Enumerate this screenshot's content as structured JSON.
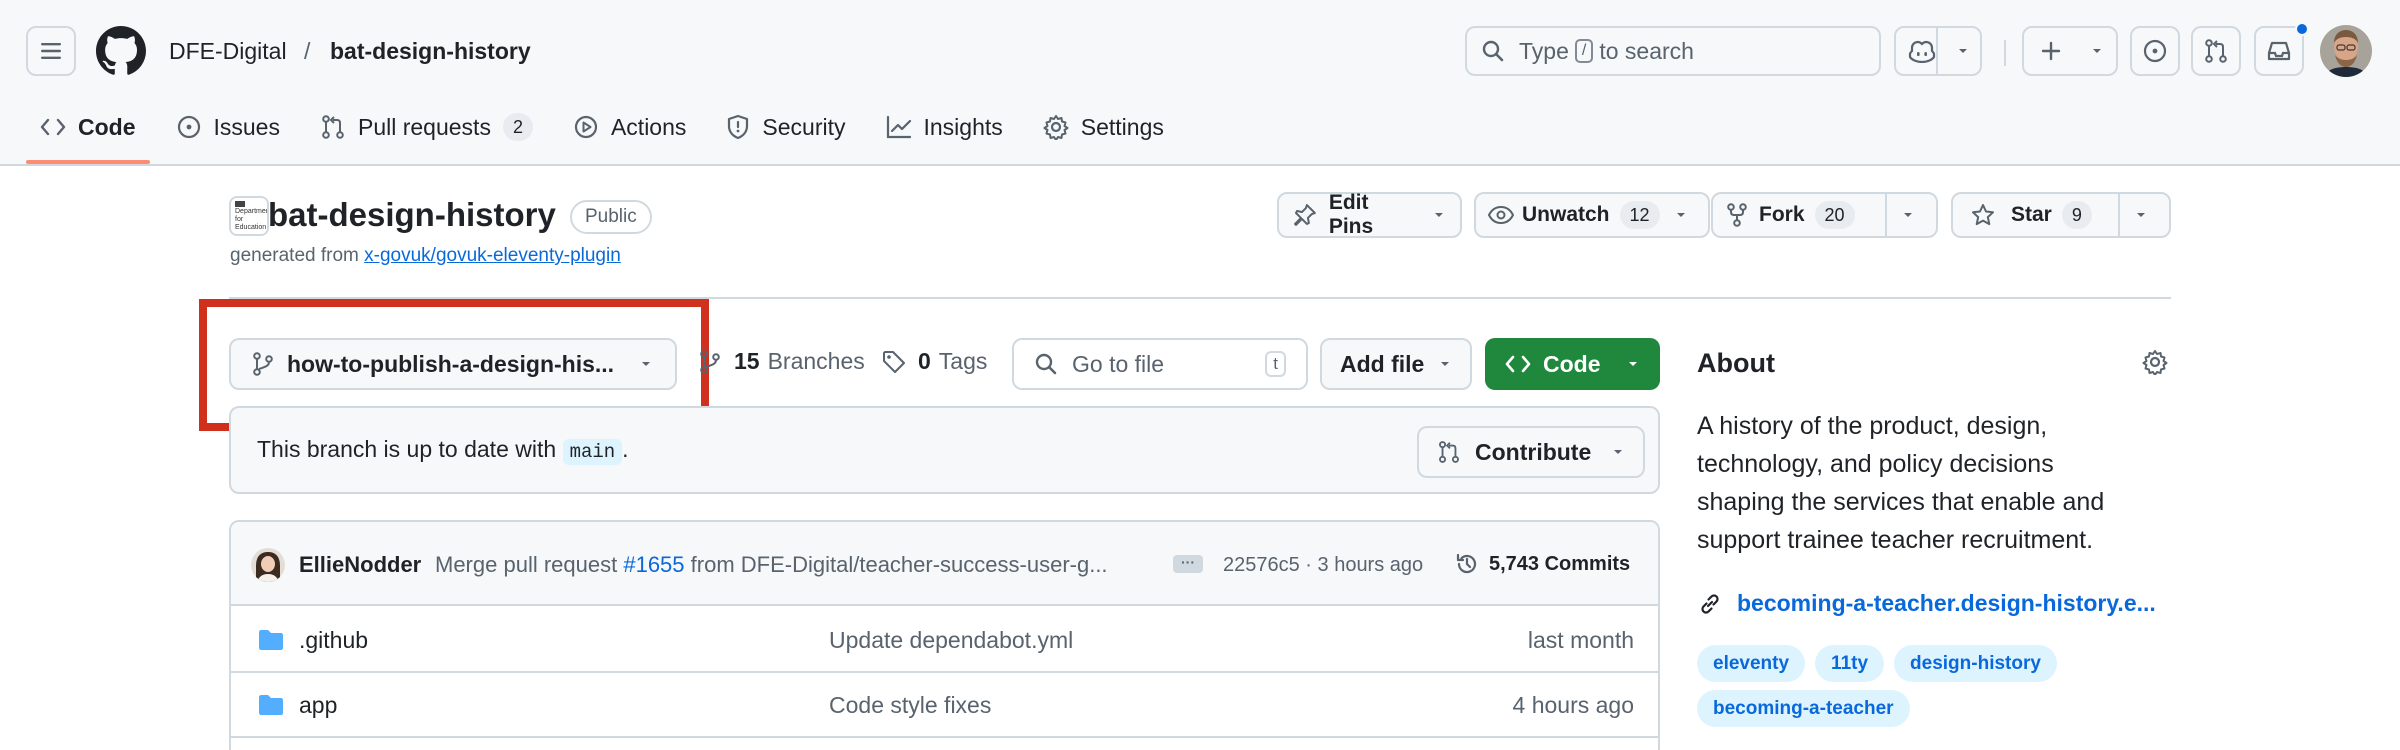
{
  "header": {
    "owner": "DFE-Digital",
    "separator": "/",
    "repo": "bat-design-history",
    "search_prefix": "Type",
    "search_key": "/",
    "search_suffix": "to search"
  },
  "tabs": [
    {
      "label": "Code",
      "icon": "code-icon",
      "active": true
    },
    {
      "label": "Issues",
      "icon": "issue-icon"
    },
    {
      "label": "Pull requests",
      "icon": "pull-request-icon",
      "count": "2"
    },
    {
      "label": "Actions",
      "icon": "play-icon"
    },
    {
      "label": "Security",
      "icon": "shield-icon"
    },
    {
      "label": "Insights",
      "icon": "graph-icon"
    },
    {
      "label": "Settings",
      "icon": "gear-icon"
    }
  ],
  "repo": {
    "name": "bat-design-history",
    "visibility": "Public",
    "generated_prefix": "generated from",
    "template": "x-govuk/govuk-eleventy-plugin",
    "org_logo_text": "Department for Education"
  },
  "actions": {
    "edit_pins": "Edit Pins",
    "unwatch": "Unwatch",
    "watch_count": "12",
    "fork": "Fork",
    "fork_count": "20",
    "star": "Star",
    "star_count": "9"
  },
  "toolbar": {
    "branch": "how-to-publish-a-design-his...",
    "branches_count": "15",
    "branches_label": "Branches",
    "tags_count": "0",
    "tags_label": "Tags",
    "go_to_file": "Go to file",
    "go_to_file_key": "t",
    "add_file": "Add file",
    "code": "Code"
  },
  "status": {
    "text": "This branch is up to date with",
    "base": "main",
    "end": ".",
    "contribute": "Contribute"
  },
  "commit": {
    "author": "EllieNodder",
    "message_prefix": "Merge pull request",
    "pr": "#1655",
    "message_suffix": "from DFE-Digital/teacher-success-user-g...",
    "sha_time": "22576c5 · 3 hours ago",
    "commits": "5,743 Commits"
  },
  "files": [
    {
      "name": ".github",
      "message": "Update dependabot.yml",
      "date": "last month"
    },
    {
      "name": "app",
      "message": "Code style fixes",
      "date": "4 hours ago"
    }
  ],
  "about": {
    "title": "About",
    "description": "A history of the product, design, technology, and policy decisions shaping the services that enable and support trainee teacher recruitment.",
    "link": "becoming-a-teacher.design-history.e...",
    "topics": [
      "eleventy",
      "11ty",
      "design-history",
      "becoming-a-teacher"
    ]
  },
  "colors": {
    "accent": "#0969da",
    "primary_button": "#1f883d",
    "highlight_box": "#d0311f",
    "active_tab_underline": "#fd8c73"
  }
}
